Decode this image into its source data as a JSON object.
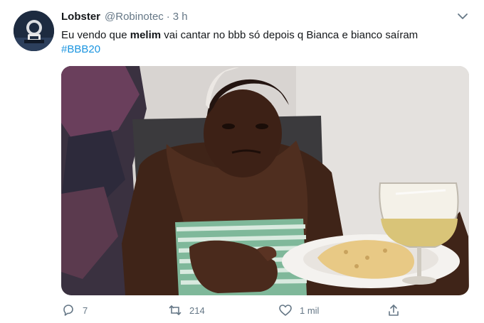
{
  "tweet": {
    "author": {
      "name": "Lobster",
      "handle": "@Robinotec",
      "time_sep": "·",
      "time": "3 h"
    },
    "text": {
      "part1": "Eu vendo que ",
      "bold": "melim",
      "part2": " vai cantar no bbb só depois q Bianca e bianco saíram",
      "hashtag": "#BBB20"
    },
    "media": {
      "icon": "photo"
    },
    "actions": {
      "reply_count": "7",
      "retweet_count": "214",
      "like_count": "1 mil"
    }
  },
  "colors": {
    "accent": "#1b95e0",
    "secondary_text": "#657786",
    "primary_text": "#14171a"
  }
}
